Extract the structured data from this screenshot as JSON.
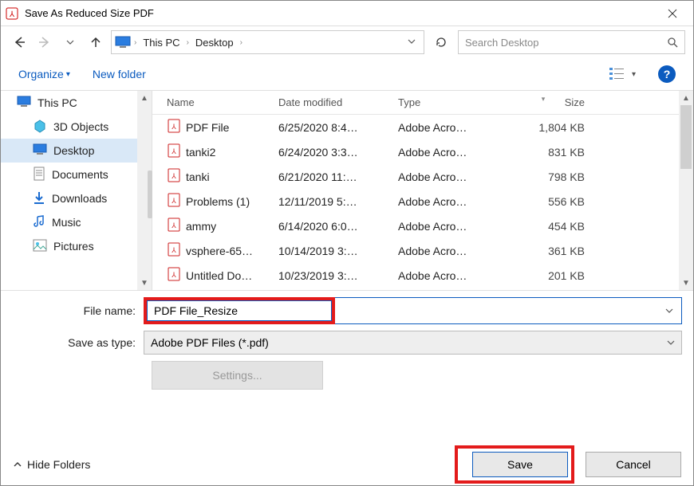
{
  "window": {
    "title": "Save As Reduced Size PDF"
  },
  "nav": {
    "crumbs": [
      "This PC",
      "Desktop"
    ],
    "search_placeholder": "Search Desktop"
  },
  "toolbar": {
    "organize": "Organize",
    "newfolder": "New folder"
  },
  "sidebar": {
    "items": [
      {
        "label": "This PC",
        "icon": "pc",
        "inset": false,
        "selected": false
      },
      {
        "label": "3D Objects",
        "icon": "3d",
        "inset": true,
        "selected": false
      },
      {
        "label": "Desktop",
        "icon": "desktop",
        "inset": true,
        "selected": true
      },
      {
        "label": "Documents",
        "icon": "documents",
        "inset": true,
        "selected": false
      },
      {
        "label": "Downloads",
        "icon": "downloads",
        "inset": true,
        "selected": false
      },
      {
        "label": "Music",
        "icon": "music",
        "inset": true,
        "selected": false
      },
      {
        "label": "Pictures",
        "icon": "pictures",
        "inset": true,
        "selected": false
      }
    ]
  },
  "columns": {
    "name": "Name",
    "date": "Date modified",
    "type": "Type",
    "size": "Size"
  },
  "files": [
    {
      "name": "PDF File",
      "date": "6/25/2020 8:4…",
      "type": "Adobe Acro…",
      "size": "1,804 KB"
    },
    {
      "name": "tanki2",
      "date": "6/24/2020 3:3…",
      "type": "Adobe Acro…",
      "size": "831 KB"
    },
    {
      "name": "tanki",
      "date": "6/21/2020 11:…",
      "type": "Adobe Acro…",
      "size": "798 KB"
    },
    {
      "name": "Problems (1)",
      "date": "12/11/2019 5:…",
      "type": "Adobe Acro…",
      "size": "556 KB"
    },
    {
      "name": "ammy",
      "date": "6/14/2020 6:0…",
      "type": "Adobe Acro…",
      "size": "454 KB"
    },
    {
      "name": "vsphere-65…",
      "date": "10/14/2019 3:…",
      "type": "Adobe Acro…",
      "size": "361 KB"
    },
    {
      "name": "Untitled Do…",
      "date": "10/23/2019 3:…",
      "type": "Adobe Acro…",
      "size": "201 KB"
    }
  ],
  "form": {
    "filename_label": "File name:",
    "filename_value": "PDF File_Resize",
    "savetype_label": "Save as type:",
    "savetype_value": "Adobe PDF Files (*.pdf)",
    "settings": "Settings..."
  },
  "footer": {
    "hide": "Hide Folders",
    "save": "Save",
    "cancel": "Cancel"
  }
}
